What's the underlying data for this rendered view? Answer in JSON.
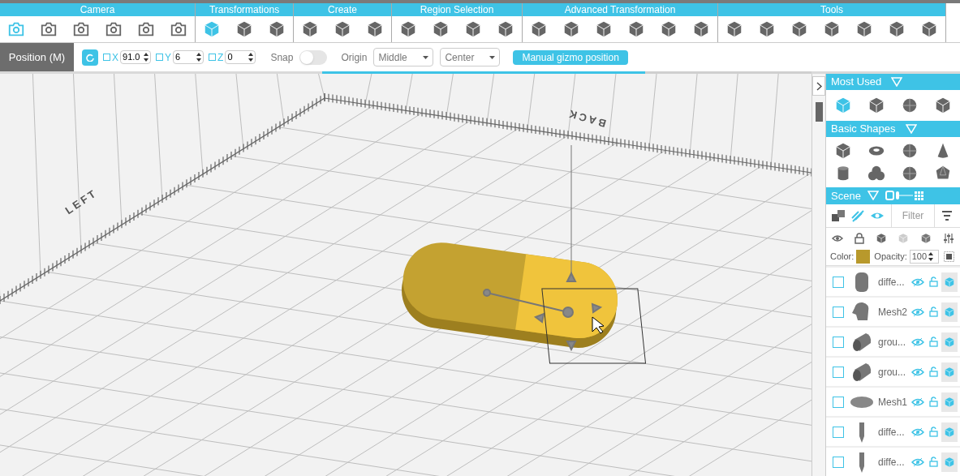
{
  "toolbar": {
    "groups": [
      {
        "label": "Camera",
        "kind": "camera",
        "tools": [
          {
            "selected": true
          },
          {
            "selected": false
          },
          {
            "selected": false
          },
          {
            "selected": false
          },
          {
            "selected": false
          },
          {
            "selected": false
          }
        ]
      },
      {
        "label": "Transformations",
        "kind": "cube",
        "tools": [
          {
            "selected": true
          },
          {
            "selected": false
          },
          {
            "selected": false
          }
        ]
      },
      {
        "label": "Create",
        "kind": "cube",
        "tools": [
          {
            "selected": false
          },
          {
            "selected": false
          },
          {
            "selected": false
          }
        ]
      },
      {
        "label": "Region Selection",
        "kind": "cube",
        "tools": [
          {
            "selected": false
          },
          {
            "selected": false
          },
          {
            "selected": false
          },
          {
            "selected": false
          }
        ]
      },
      {
        "label": "Advanced Transformation",
        "kind": "cube",
        "tools": [
          {
            "selected": false
          },
          {
            "selected": false
          },
          {
            "selected": false
          },
          {
            "selected": false
          },
          {
            "selected": false
          },
          {
            "selected": false
          }
        ]
      },
      {
        "label": "Tools",
        "kind": "cube",
        "tools": [
          {
            "selected": false
          },
          {
            "selected": false
          },
          {
            "selected": false
          },
          {
            "selected": false
          },
          {
            "selected": false
          },
          {
            "selected": false
          },
          {
            "selected": false
          }
        ]
      }
    ]
  },
  "options": {
    "mode": "Position (M)",
    "axes": [
      {
        "label": "X",
        "checked": false,
        "value": "91.0"
      },
      {
        "label": "Y",
        "checked": false,
        "value": "6"
      },
      {
        "label": "Z",
        "checked": false,
        "value": "0"
      }
    ],
    "snap": {
      "label": "Snap",
      "on": false
    },
    "origin": {
      "label": "Origin",
      "values": [
        "Middle",
        "Center"
      ]
    },
    "gizmo_button": "Manual gizmo position"
  },
  "loading_bar": {
    "level": 0.66
  },
  "viewport": {
    "axis_labels": [
      "LEFT",
      "BACK"
    ]
  },
  "sidebar": {
    "most_used": {
      "title": "Most Used",
      "icons": [
        {
          "kind": "cube"
        },
        {
          "kind": "cube"
        },
        {
          "kind": "sphere"
        },
        {
          "kind": "cube"
        }
      ]
    },
    "basic_shapes": {
      "title": "Basic Shapes",
      "icons": [
        {
          "kind": "cube"
        },
        {
          "kind": "torus"
        },
        {
          "kind": "sphere"
        },
        {
          "kind": "cone"
        },
        {
          "kind": "cylinder"
        },
        {
          "kind": "knot"
        },
        {
          "kind": "sphere"
        },
        {
          "kind": "polyhedron"
        }
      ]
    },
    "scene": {
      "title": "Scene",
      "filter_placeholder": "Filter",
      "color_label": "Color:",
      "color": "#b8992c",
      "opacity_label": "Opacity:",
      "opacity": "100",
      "items": [
        {
          "name": "diffe...",
          "kind": "cylinder",
          "checked": false
        },
        {
          "name": "Mesh2",
          "kind": "mesh",
          "checked": false
        },
        {
          "name": "grou...",
          "kind": "tube",
          "checked": false
        },
        {
          "name": "grou...",
          "kind": "tube",
          "checked": false
        },
        {
          "name": "Mesh1",
          "kind": "disc",
          "checked": false
        },
        {
          "name": "diffe...",
          "kind": "pin",
          "checked": false
        },
        {
          "name": "diffe...",
          "kind": "pin",
          "checked": false
        }
      ]
    }
  }
}
